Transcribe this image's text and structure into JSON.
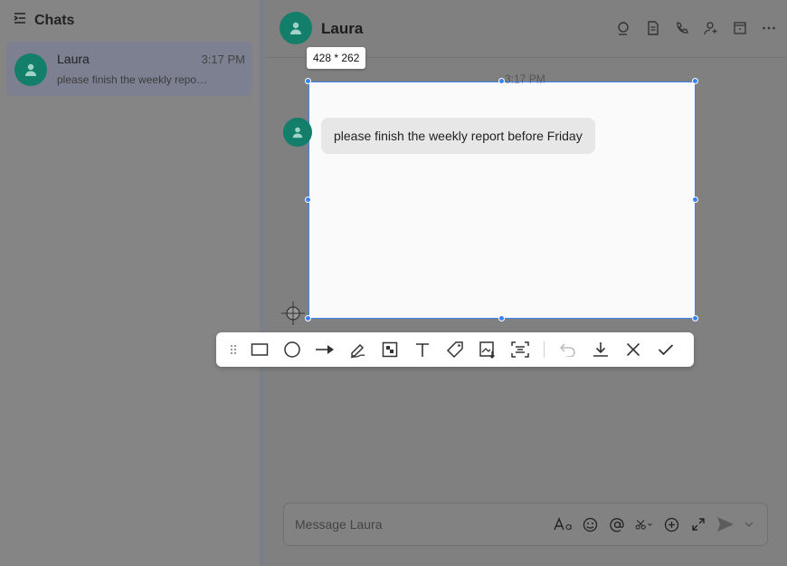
{
  "sidebar": {
    "title": "Chats",
    "chats": [
      {
        "name": "Laura",
        "time": "3:17 PM",
        "preview": "please finish the weekly report before Friday"
      }
    ]
  },
  "conversation": {
    "contact_name": "Laura",
    "timestamp": "3:17 PM",
    "messages": [
      {
        "text": "please finish the weekly report before Friday"
      }
    ],
    "header_actions": [
      "search-icon",
      "document-icon",
      "phone-icon",
      "add-member-icon",
      "calendar-icon",
      "more-icon"
    ],
    "composer_placeholder": "Message Laura",
    "composer_tools": [
      "format-text-icon",
      "emoji-icon",
      "mention-icon",
      "scissors-icon",
      "add-icon",
      "expand-icon",
      "send-icon",
      "chevron-down-icon"
    ]
  },
  "screenshot_tool": {
    "size_label": "428 * 262",
    "tools": [
      "rectangle-icon",
      "circle-icon",
      "arrow-icon",
      "pen-icon",
      "mosaic-icon",
      "text-icon",
      "tag-icon",
      "pin-image-icon",
      "ocr-icon",
      "undo-icon",
      "download-icon",
      "close-icon",
      "confirm-icon"
    ]
  },
  "colors": {
    "accent": "#3b82f6",
    "avatar": "#137e6a"
  }
}
